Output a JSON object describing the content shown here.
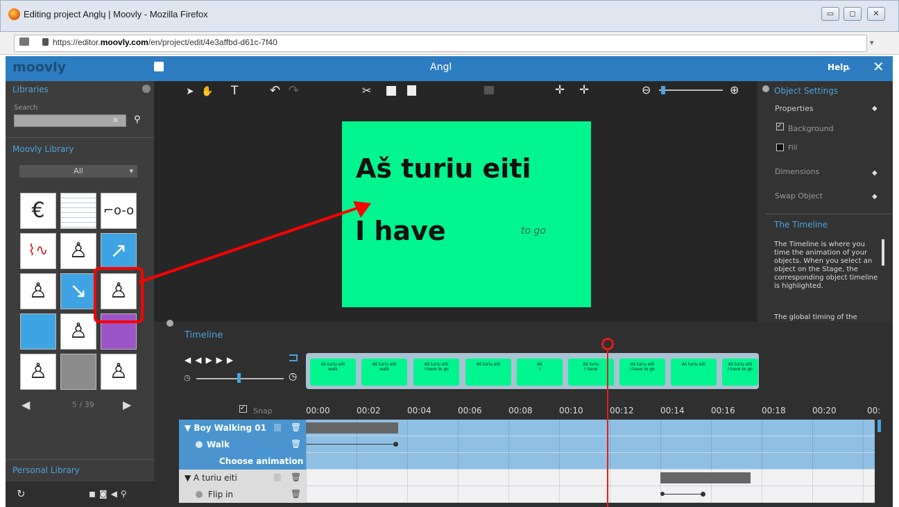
{
  "window": {
    "title": "Editing project Anglų | Moovly - Mozilla Firefox",
    "url_prefix": "https://editor.",
    "url_domain": "moovly.com",
    "url_suffix": "/en/project/edit/4e3affbd-d61c-7f40"
  },
  "app": {
    "logo": "moovly",
    "project_title": "Angl",
    "help_label": "Help",
    "close_label": "✕"
  },
  "libraries": {
    "title": "Libraries",
    "search_label": "Search",
    "search_placeholder": "",
    "moovly_library": "Moovly Library",
    "filter_value": "All",
    "pager": "5 / 39",
    "personal_library": "Personal Library"
  },
  "toolbar": {
    "text_tool": "T"
  },
  "canvas": {
    "line1": "Aš turiu eiti",
    "line2": "I have",
    "line3": "to go",
    "bg_color": "#00f58f"
  },
  "object_settings": {
    "title": "Object Settings",
    "properties": "Properties",
    "background": "Background",
    "fill": "Fill",
    "dimensions": "Dimensions",
    "swap_object": "Swap Object"
  },
  "help_panel": {
    "title": "The Timeline",
    "body": "The Timeline is where you time the animation of your objects. When you select an object on the Stage, the corresponding object timeline is highlighted.",
    "body2": "The global timing of the"
  },
  "timeline": {
    "title": "Timeline",
    "snap_label": "Snap",
    "ticks": [
      "00:00",
      "00:02",
      "00:04",
      "00:06",
      "00:08",
      "00:10",
      "00:12",
      "00:14",
      "00:16",
      "00:18",
      "00:20",
      "00:"
    ],
    "frames": [
      {
        "t": "Aš turiu eiti",
        "s": "walk"
      },
      {
        "t": "Aš turiu eiti",
        "s": "walk"
      },
      {
        "t": "Aš turiu eiti",
        "s": "I have to go"
      },
      {
        "t": "Aš turiu eiti",
        "s": ""
      },
      {
        "t": "Aš",
        "s": "I"
      },
      {
        "t": "Aš turiu",
        "s": "I have"
      },
      {
        "t": "Aš turiu eiti",
        "s": "I have to go"
      },
      {
        "t": "Aš turiu eiti",
        "s": ""
      },
      {
        "t": "Aš turiu eiti",
        "s": "I have to go"
      }
    ],
    "rows": [
      {
        "label": "▼ Boy Walking 01",
        "style": "sel-bold"
      },
      {
        "label": "Walk",
        "style": "sel-sub"
      },
      {
        "label": "Choose animation ▾",
        "style": "sel-choose"
      },
      {
        "label": "▼ A turiu eiti",
        "style": "normal"
      },
      {
        "label": "Flip in",
        "style": "sub"
      }
    ]
  }
}
